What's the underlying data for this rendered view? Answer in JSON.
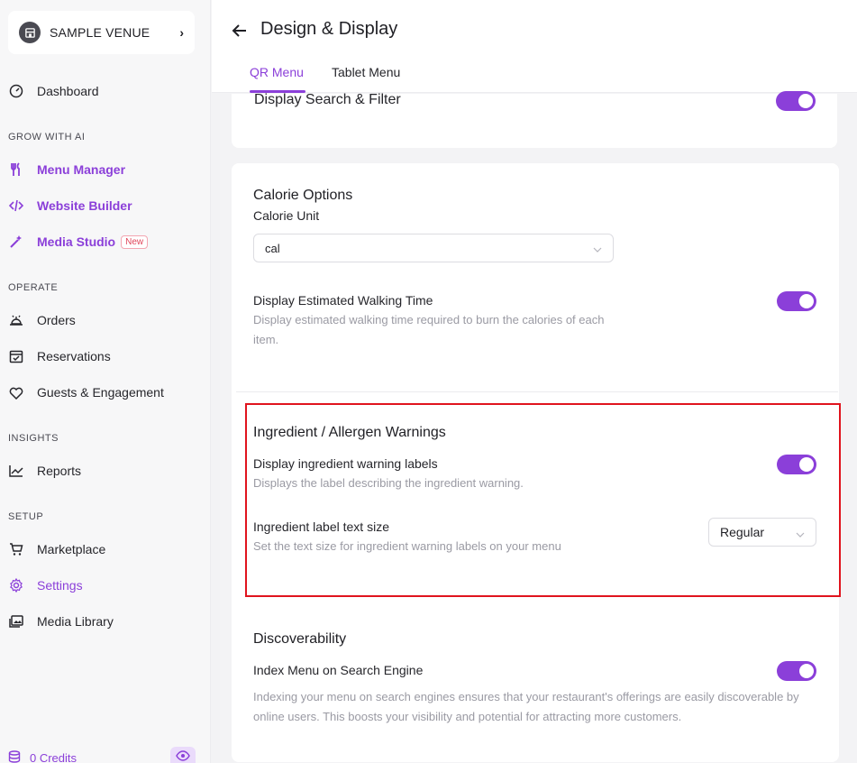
{
  "venue": {
    "name": "SAMPLE VENUE"
  },
  "nav": {
    "dashboard": "Dashboard",
    "grow_label": "GROW WITH AI",
    "menu_manager": "Menu Manager",
    "website_builder": "Website Builder",
    "media_studio": "Media Studio",
    "new_badge": "New",
    "operate_label": "OPERATE",
    "orders": "Orders",
    "reservations": "Reservations",
    "guests": "Guests & Engagement",
    "insights_label": "INSIGHTS",
    "reports": "Reports",
    "setup_label": "SETUP",
    "marketplace": "Marketplace",
    "settings": "Settings",
    "media_library": "Media Library",
    "credits": "0 Credits"
  },
  "header": {
    "title": "Design & Display",
    "tabs": [
      {
        "label": "QR Menu",
        "active": true
      },
      {
        "label": "Tablet Menu",
        "active": false
      }
    ]
  },
  "search_filter": {
    "label": "Display Search & Filter",
    "enabled": true
  },
  "calorie": {
    "title": "Calorie Options",
    "unit_label": "Calorie Unit",
    "unit_value": "cal",
    "walking_label": "Display Estimated Walking Time",
    "walking_desc": "Display estimated walking time required to burn the calories of each item.",
    "walking_enabled": true
  },
  "allergen": {
    "title": "Ingredient / Allergen Warnings",
    "warning_label": "Display ingredient warning labels",
    "warning_desc": "Displays the label describing the ingredient warning.",
    "warning_enabled": true,
    "size_label": "Ingredient label text size",
    "size_desc": "Set the text size for ingredient warning labels on your menu",
    "size_value": "Regular"
  },
  "discover": {
    "title": "Discoverability",
    "index_label": "Index Menu on Search Engine",
    "index_desc": "Indexing your menu on search engines ensures that your restaurant's offerings are easily discoverable by online users. This boosts your visibility and potential for attracting more customers.",
    "index_enabled": true
  },
  "colors": {
    "accent": "#8b3fd9",
    "highlight": "#e0141e"
  }
}
